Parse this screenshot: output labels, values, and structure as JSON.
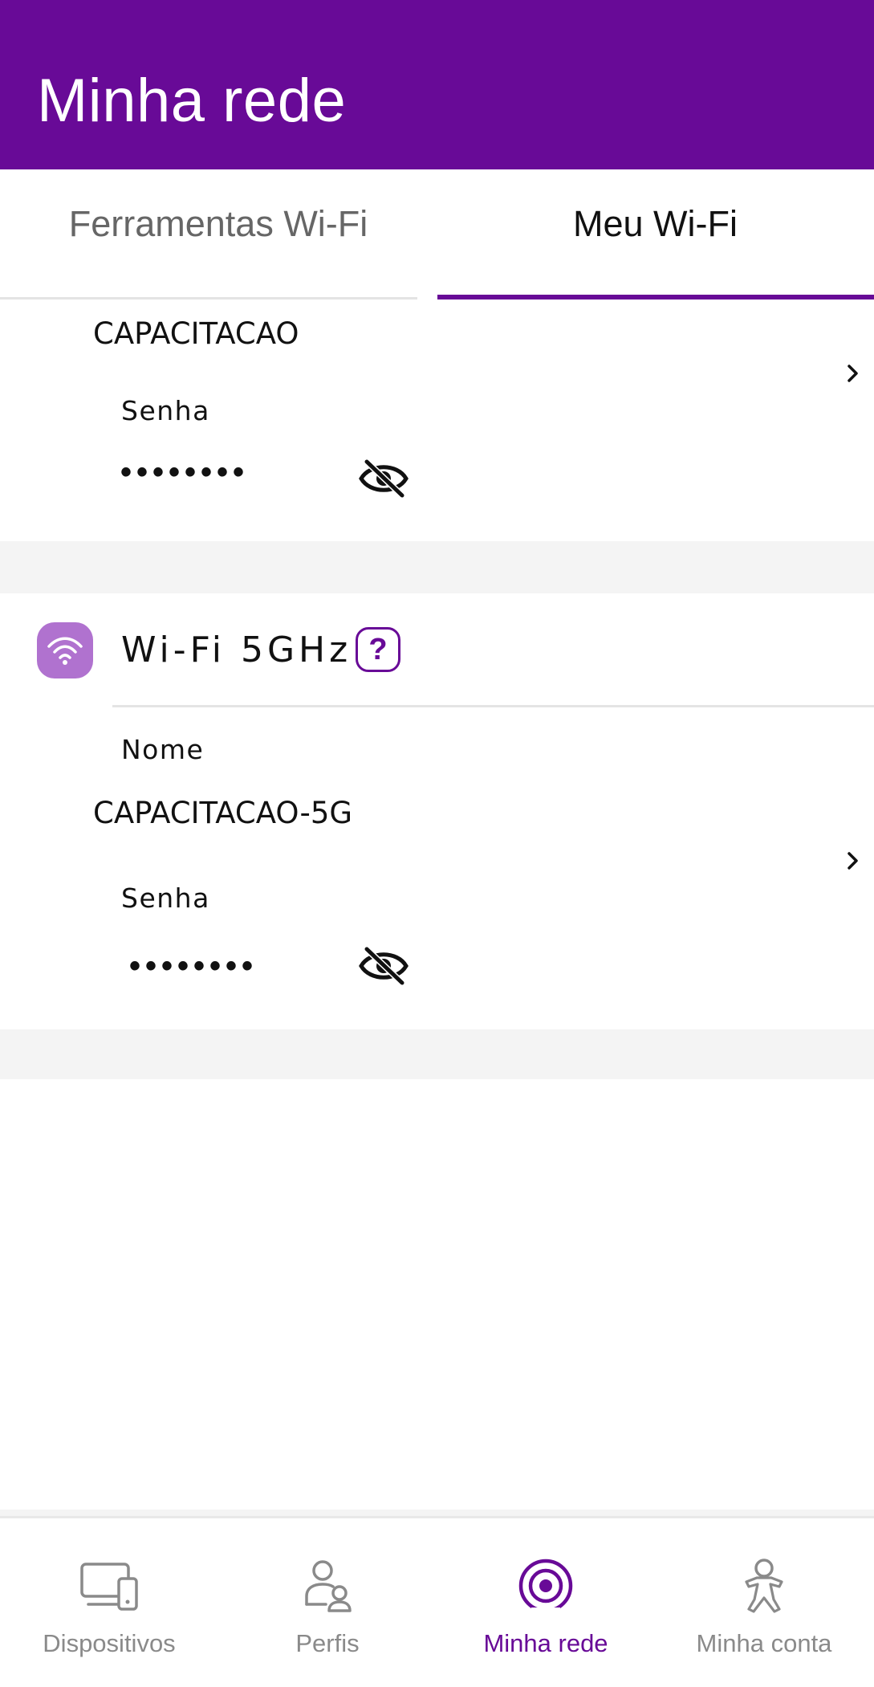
{
  "header": {
    "title": "Minha rede"
  },
  "tabs": [
    {
      "label": "Ferramentas Wi-Fi",
      "active": false
    },
    {
      "label": "Meu Wi-Fi",
      "active": true
    }
  ],
  "network_24": {
    "ssid": "CAPACITACAO",
    "password_label": "Senha",
    "password_masked": "••••••••"
  },
  "network_5g": {
    "band_title": "Wi-Fi 5GHz",
    "help_glyph": "?",
    "name_label": "Nome",
    "ssid": "CAPACITACAO-5G",
    "password_label": "Senha",
    "password_masked": "••••••••"
  },
  "icons": [
    "chevron-right-icon",
    "eye-off-icon",
    "wifi-icon",
    "help-icon",
    "devices-icon",
    "profiles-icon",
    "network-icon",
    "account-icon"
  ],
  "bottom_nav": {
    "items": [
      {
        "label": "Dispositivos",
        "active": false
      },
      {
        "label": "Perfis",
        "active": false
      },
      {
        "label": "Minha rede",
        "active": true
      },
      {
        "label": "Minha conta",
        "active": false
      }
    ]
  },
  "colors": {
    "brand": "#680a97",
    "badge": "#b072cf",
    "inactive": "#8a8a8a"
  }
}
